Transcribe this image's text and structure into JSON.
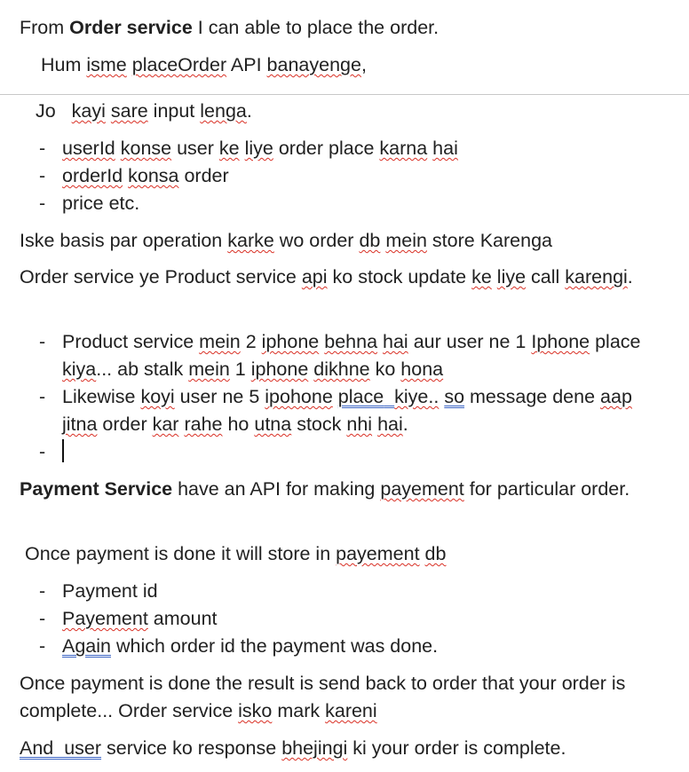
{
  "doc": {
    "p1": {
      "a": "From ",
      "b": "Order service",
      "c": " I can able to place the order."
    },
    "p2": {
      "a": "Hum ",
      "isme": "isme",
      "s1": " ",
      "placeOrder": "placeOrder",
      "c": " API ",
      "banayenge": "banayenge",
      "d": ","
    },
    "p3": {
      "a": "Jo   ",
      "kayi": "kayi",
      "s1": " ",
      "sare": "sare",
      "c": " input ",
      "lenga": "lenga",
      "d": "."
    },
    "list1": {
      "dash": "-",
      "i1": {
        "userId": "userId",
        "s1": " ",
        "konse": "konse",
        "a": " user ",
        "ke": "ke",
        "s2": " ",
        "liye": "liye",
        "b": " order place ",
        "karna": "karna",
        "s3": " ",
        "hai": "hai"
      },
      "i2": {
        "orderId": "orderId",
        "s1": " ",
        "konsa": "konsa",
        "a": " order"
      },
      "i3": "price etc."
    },
    "p4": {
      "a": "Iske basis par operation ",
      "karke": "karke",
      "b": " wo order ",
      "db": "db",
      "s1": " ",
      "mein": "mein",
      "c": " store Karenga"
    },
    "p5": {
      "a": "Order service ye Product service ",
      "api": "api",
      "b": " ko stock update ",
      "ke": "ke",
      "s1": " ",
      "liye": "liye",
      "c": " call ",
      "karengi": "karengi",
      "d": "."
    },
    "list2": {
      "dash": "-",
      "i1": {
        "a": "Product service ",
        "mein": "mein",
        "b": " 2 ",
        "iphone": "iphone",
        "s1": " ",
        "behna": "behna",
        "s2": " ",
        "hai": "hai",
        "c": " aur user ne 1 ",
        "Iphone": "Iphone",
        "d": " place ",
        "kiya": "kiya",
        "e": "... ab stalk ",
        "mein2": "mein",
        "f": " 1 ",
        "iphone2": "iphone",
        "s3": " ",
        "dikhne": "dikhne",
        "g": " ko ",
        "hona": "hona"
      },
      "i2": {
        "a": "Likewise ",
        "koyi": "koyi",
        "b": " user ne 5 ",
        "ipohone": "ipohone",
        "s1": " ",
        "place": "place",
        "s2": "  ",
        "kiye": "kiye..",
        "s3": " ",
        "so": "so",
        "c": " message dene ",
        "aap": "aap",
        "s4": " ",
        "jitna": "jitna",
        "d": " order ",
        "kar": "kar",
        "s5": " ",
        "rahe": "rahe",
        "e": " ho ",
        "utna": "utna",
        "f": " stock ",
        "nhi": "nhi",
        "s6": " ",
        "hai": "hai",
        "g": "."
      }
    },
    "p6": {
      "b": "Payment Service",
      "a": " have an API for making ",
      "payement": "payement",
      "c": " for particular order."
    },
    "p7": {
      "a": "Once payment is done it will store in ",
      "payement": "payement",
      "s1": " ",
      "db": "db"
    },
    "list3": {
      "dash": "-",
      "i1": "Payment id",
      "i2": {
        "payement": "Payement",
        "a": " amount"
      },
      "i3": {
        "again": "Again",
        "a": " which order id the payment was done."
      }
    },
    "p8": {
      "a": "Once payment is done the result is send back to order that your order is complete... Order service ",
      "isko": "isko",
      "b": " mark ",
      "kareni": "kareni"
    },
    "p9": {
      "andUser": "And  user",
      "a": " service ko response ",
      "bhejingi": "bhejingi",
      "b": " ki your order is complete."
    }
  }
}
